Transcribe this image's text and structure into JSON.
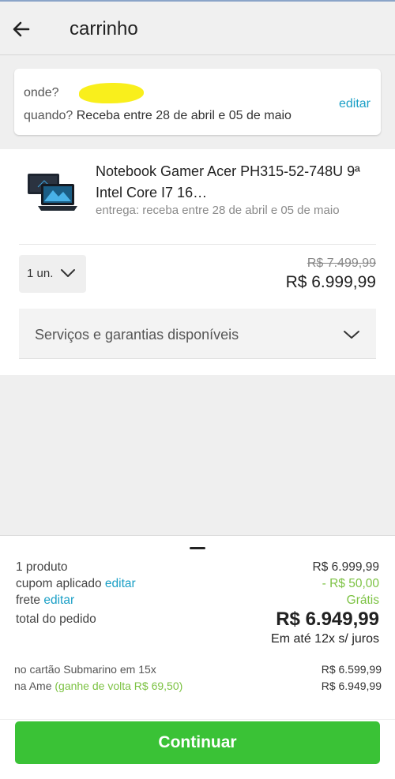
{
  "header": {
    "title": "carrinho",
    "back_icon": "arrow-left-icon"
  },
  "delivery": {
    "where_label": "onde?",
    "when_label": "quando?",
    "when_value": "Receba entre 28 de abril e 05 de maio",
    "edit_label": "editar"
  },
  "product": {
    "name": "Notebook Gamer Acer PH315-52-748U 9ª Intel Core I7 16…",
    "delivery": "entrega: receba entre 28 de abril e 05 de maio",
    "quantity": "1 un.",
    "old_price": "R$ 7.499,99",
    "price": "R$ 6.999,99",
    "services_label": "Serviços e garantias disponíveis"
  },
  "summary": {
    "products_label": "1 produto",
    "products_value": "R$ 6.999,99",
    "coupon_label": "cupom aplicado",
    "coupon_edit": "editar",
    "coupon_value": "- R$ 50,00",
    "shipping_label": "frete",
    "shipping_edit": "editar",
    "shipping_value": "Grátis",
    "total_label": "total do pedido",
    "total_value": "R$ 6.949,99",
    "installments": "Em até 12x s/ juros",
    "card_label": "no cartão Submarino em 15x",
    "card_value": "R$ 6.599,99",
    "ame_label": "na Ame",
    "ame_cashback": "(ganhe de volta R$ 69,50)",
    "ame_value": "R$ 6.949,99",
    "continue_label": "Continuar"
  },
  "colors": {
    "accent_link": "#1a9fc6",
    "green": "#7cc243",
    "button": "#3ac236"
  }
}
